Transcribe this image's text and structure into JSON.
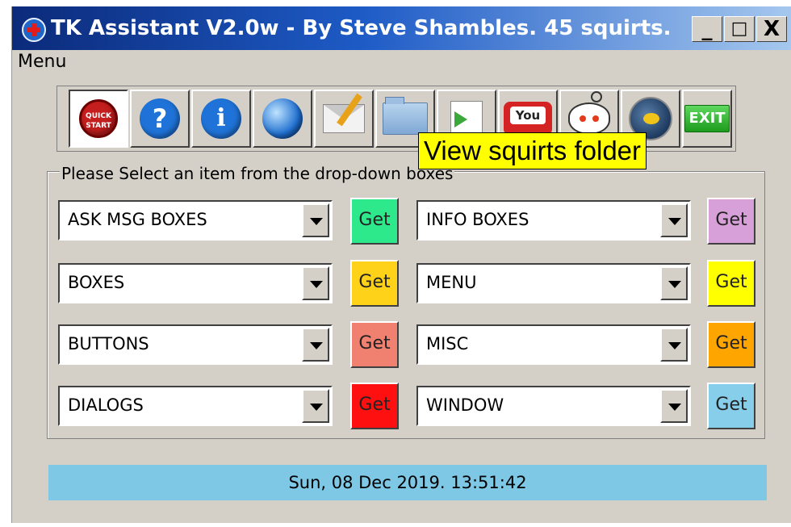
{
  "window": {
    "title": "TK Assistant V2.0w - By Steve Shambles. 45 squirts.",
    "minimize_label": "_",
    "maximize_label": "□",
    "close_label": "X"
  },
  "menu": {
    "label": "Menu"
  },
  "toolbar": {
    "buttons": [
      {
        "icon": "quick-start-icon",
        "icon_text": "QUICK START"
      },
      {
        "icon": "help-icon",
        "icon_text": "?"
      },
      {
        "icon": "info-icon",
        "icon_text": "i"
      },
      {
        "icon": "globe-icon"
      },
      {
        "icon": "mail-icon"
      },
      {
        "icon": "folder-icon"
      },
      {
        "icon": "copy-files-icon"
      },
      {
        "icon": "youtube-icon",
        "icon_text": "You"
      },
      {
        "icon": "reddit-icon"
      },
      {
        "icon": "python-icon"
      },
      {
        "icon": "exit-icon",
        "icon_text": "EXIT"
      }
    ],
    "tooltip": "View squirts folder"
  },
  "group": {
    "label": "Please Select an item from the drop-down boxes",
    "left_combos": [
      {
        "value": "ASK MSG BOXES",
        "button_label": "Get",
        "button_color": "#2ee88c"
      },
      {
        "value": "BOXES",
        "button_label": "Get",
        "button_color": "#ffd21a"
      },
      {
        "value": "BUTTONS",
        "button_label": "Get",
        "button_color": "#f08070"
      },
      {
        "value": "DIALOGS",
        "button_label": "Get",
        "button_color": "#ff1010"
      }
    ],
    "right_combos": [
      {
        "value": "INFO BOXES",
        "button_label": "Get",
        "button_color": "#d8a0d8"
      },
      {
        "value": "MENU",
        "button_label": "Get",
        "button_color": "#ffff00"
      },
      {
        "value": "MISC",
        "button_label": "Get",
        "button_color": "#ffa500"
      },
      {
        "value": "WINDOW",
        "button_label": "Get",
        "button_color": "#87ceeb"
      }
    ]
  },
  "status_bar": {
    "text": "Sun, 08 Dec 2019. 13:51:42",
    "color": "#7ec8e6"
  }
}
